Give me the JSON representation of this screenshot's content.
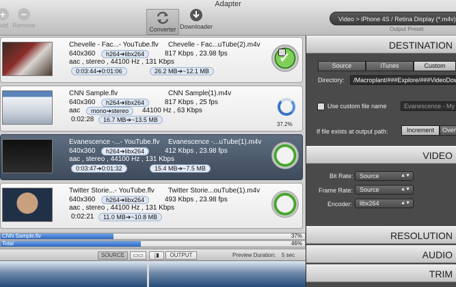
{
  "window": {
    "title": "Adapter"
  },
  "toolbar": {
    "add_label": "Add",
    "remove_label": "Remove",
    "converter_label": "Converter",
    "downloader_label": "Downloader",
    "preset_value": "Video > iPhone 4S / Retina Display (*.m4v)",
    "preset_caption": "Output Preset"
  },
  "files": [
    {
      "name": "Chevelle - Fac...- YouTube.flv",
      "output": "Chevelle - Fac...uTube(2).m4v",
      "resolution": "640x360",
      "codec": "h264➔libx264",
      "bitrate": "817 Kbps , 23.98 fps",
      "audio": "aac , stereo , 44100 Hz , 131 Kbps",
      "audio_pill": "",
      "duration": "0:03:44➔0:01:06",
      "size": "26.2 MB➔~12.1 MB",
      "status": "done"
    },
    {
      "name": "CNN Sample.flv",
      "output": "CNN Sample(1).m4v",
      "resolution": "640x360",
      "codec": "h264➔libx264",
      "bitrate": "817 Kbps , 25 fps",
      "audio": "aac",
      "audio_pill": "mono➔stereo",
      "audio_rest": "44100 Hz , 63 Kbps",
      "duration": "0:02:28",
      "size": "16.7 MB➔~13.5 MB",
      "status": "converting",
      "progress_label": "37.2%"
    },
    {
      "name": "Evanescence -...- YouTube.flv",
      "output": "Evanescence -...uTube(1).m4v",
      "resolution": "640x360",
      "codec": "h264➔libx264",
      "bitrate": "412 Kbps , 23.98 fps",
      "audio": "aac , stereo , 44100 Hz , 131 Kbps",
      "audio_pill": "",
      "duration": "0:03:47➔0:01:32",
      "size": "15.4 MB➔~7.5 MB",
      "status": "queued"
    },
    {
      "name": "Twitter Storie...- YouTube.flv",
      "output": "Twitter Storie...ouTube(1).m4v",
      "resolution": "640x360",
      "codec": "h264➔libx264",
      "bitrate": "493 Kbps , 23.98 fps",
      "audio": "aac , stereo , 44100 Hz , 131 Kbps",
      "audio_pill": "",
      "duration": "0:02:21",
      "size": "11.0 MB➔~10.8 MB",
      "status": "queued"
    }
  ],
  "progress": [
    {
      "label": "CNN Sample.flv",
      "value_label": "37%",
      "value": 0.37
    },
    {
      "label": "Total",
      "value_label": "46%",
      "value": 0.46
    }
  ],
  "preview": {
    "source_label": "SOURCE",
    "output_label": "OUTPUT",
    "duration_label": "Preview Duration:",
    "duration_value": "5 sec"
  },
  "destination": {
    "header": "DESTINATION",
    "tabs": [
      "Source",
      "iTunes",
      "Custom"
    ],
    "directory_label": "Directory:",
    "directory_value": "/Macroplant/###Explore/###VideoDownloads",
    "custom_name_label": "Use custom file name",
    "custom_name_value": "Evanescence - My Immortal",
    "exists_label": "If file exists at output path:",
    "exists_options": [
      "Increment",
      "Overwrite"
    ]
  },
  "video": {
    "header": "VIDEO",
    "bitrate_label": "Bit Rate:",
    "bitrate_value": "Source",
    "framerate_label": "Frame Rate:",
    "framerate_value": "Source",
    "encoder_label": "Encoder:",
    "encoder_value": "libx264"
  },
  "sections": {
    "resolution": "RESOLUTION",
    "audio": "AUDIO",
    "trim": "TRIM"
  }
}
